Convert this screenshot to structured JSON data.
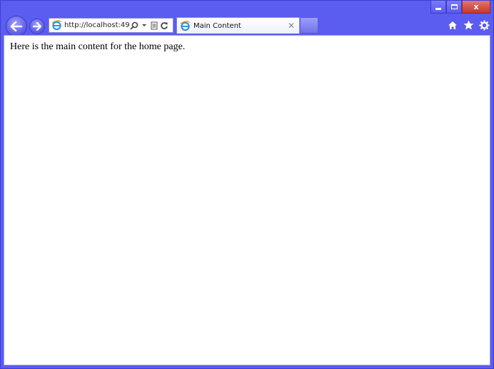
{
  "browser": {
    "address_url": "http://localhost:49",
    "tab_title": "Main Content",
    "tab_close_glyph": "✕",
    "caption_close_glyph": "x"
  },
  "icons": {
    "back": "arrow-left-icon",
    "forward": "arrow-right-icon",
    "page": "internet-explorer-icon",
    "search": "search-icon",
    "dropdown": "chevron-down-icon",
    "compatibility": "compatibility-view-icon",
    "refresh": "refresh-icon",
    "home": "home-icon",
    "favorites": "star-icon",
    "tools": "gear-icon"
  },
  "page": {
    "main_text": "Here is the main content for the home page."
  },
  "colors": {
    "frame": "#5b5cf0",
    "close_button": "#c7372a"
  }
}
